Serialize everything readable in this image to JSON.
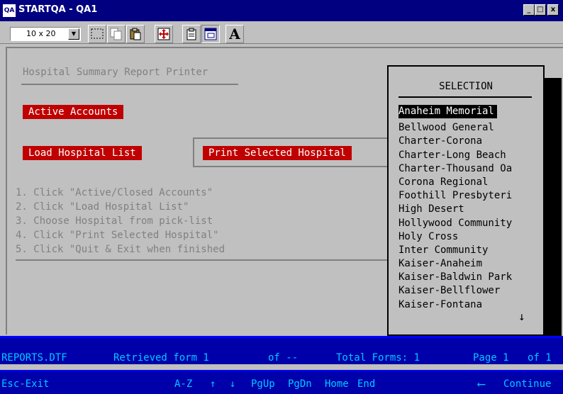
{
  "window": {
    "icon_label": "QA",
    "title": "STARTQA - QA1",
    "minimize": "_",
    "maximize": "□",
    "close": "x"
  },
  "toolbar": {
    "font_size": "10 x 20",
    "bold_label": "A"
  },
  "screen": {
    "heading": "Hospital Summary Report Printer",
    "active_accounts_button": "Active Accounts",
    "load_hospital_button": "Load Hospital List",
    "print_selected_button": "Print Selected Hospital",
    "instructions": [
      "1. Click \"Active/Closed Accounts\"",
      "2. Click \"Load Hospital List\"",
      "3. Choose Hospital from pick-list",
      "4. Click \"Print Selected Hospital\"",
      "5. Click \"Quit & Exit when finished"
    ]
  },
  "selection": {
    "title": "SELECTION",
    "items": [
      "Anaheim Memorial",
      "Bellwood General",
      "Charter-Corona",
      "Charter-Long Beach",
      "Charter-Thousand Oa",
      "Corona Regional",
      "Foothill Presbyteri",
      "High Desert",
      "Hollywood Community",
      "Holy Cross",
      "Inter Community",
      "Kaiser-Anaheim",
      "Kaiser-Baldwin Park",
      "Kaiser-Bellflower",
      "Kaiser-Fontana"
    ],
    "selected_index": 0,
    "more_indicator": "↓"
  },
  "status": {
    "file": "REPORTS.DTF",
    "retrieved": "Retrieved form 1",
    "of": "of --",
    "total_forms": "Total Forms: 1",
    "page": "Page 1",
    "page_of": "of 1"
  },
  "keys": {
    "esc": "Esc-Exit",
    "az": "A-Z",
    "up": "↑",
    "down": "↓",
    "pgup": "PgUp",
    "pgdn": "PgDn",
    "home": "Home",
    "end": "End",
    "continue_icon": "⟵",
    "continue": "Continue"
  },
  "colors": {
    "title_bar": "#000080",
    "button_red": "#c00000",
    "status_bg": "#0000aa",
    "status_text": "#00c8ff"
  }
}
